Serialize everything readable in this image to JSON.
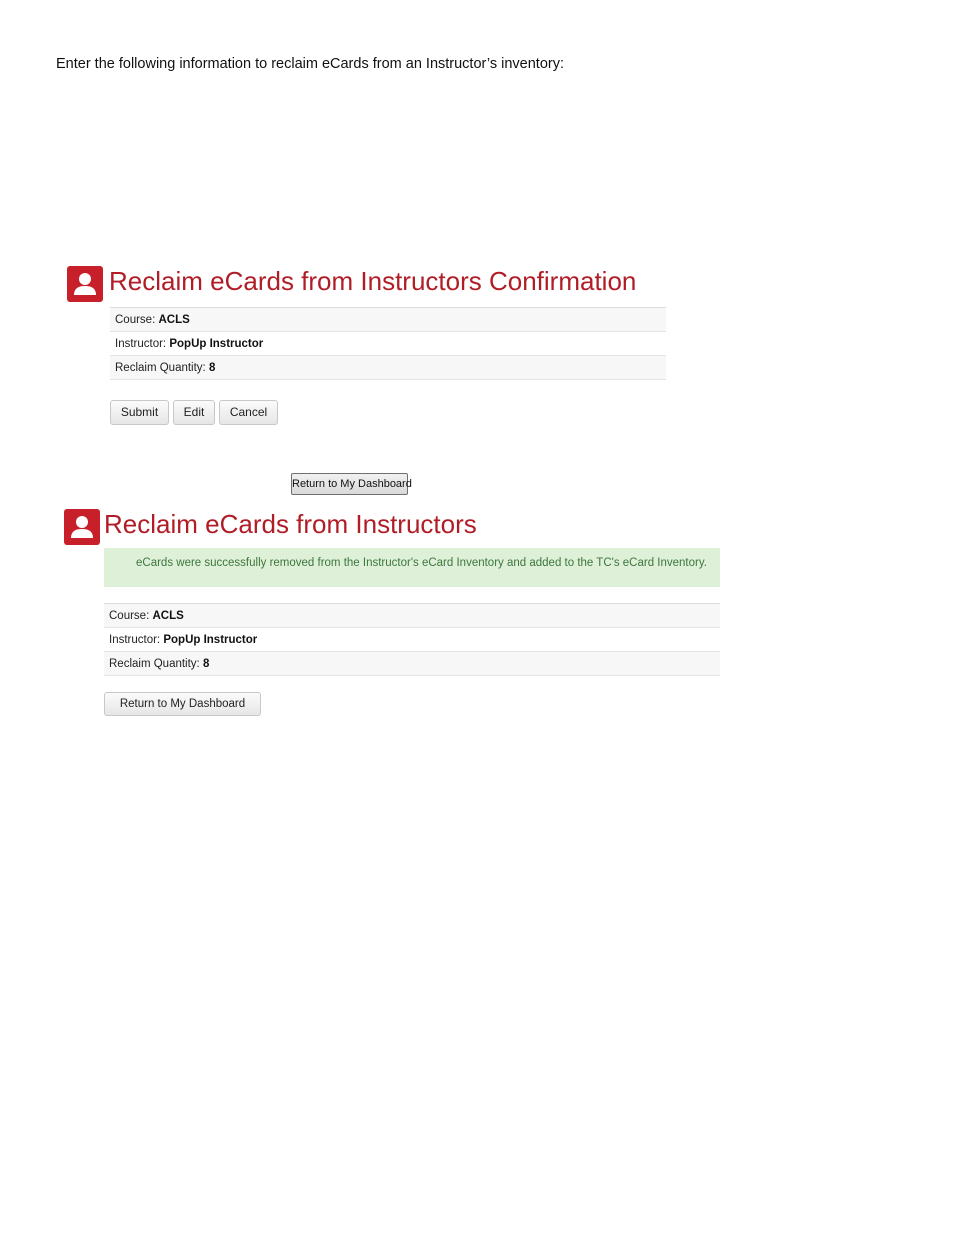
{
  "intro_text": "Enter the following information to reclaim eCards from an Instructor’s inventory:",
  "confirmation": {
    "title": "Reclaim eCards from Instructors Confirmation",
    "icon": "user-icon",
    "rows": [
      {
        "label": "Course:",
        "value": "ACLS"
      },
      {
        "label": "Instructor:",
        "value": "PopUp Instructor"
      },
      {
        "label": "Reclaim Quantity:",
        "value": "8"
      }
    ],
    "buttons": {
      "submit": "Submit",
      "edit": "Edit",
      "cancel": "Cancel"
    },
    "return_button": "Return to My Dashboard"
  },
  "result": {
    "title": "Reclaim eCards from Instructors",
    "icon": "user-icon",
    "success_message": "eCards were successfully removed from the Instructor's eCard Inventory and added to the TC's eCard Inventory.",
    "rows": [
      {
        "label": "Course:",
        "value": "ACLS"
      },
      {
        "label": "Instructor:",
        "value": "PopUp Instructor"
      },
      {
        "label": "Reclaim Quantity:",
        "value": "8"
      }
    ],
    "return_button": "Return to My Dashboard"
  },
  "colors": {
    "accent": "#c8202b",
    "heading": "#b11d27",
    "success_bg": "#dff0d8",
    "success_text": "#3c763d"
  }
}
